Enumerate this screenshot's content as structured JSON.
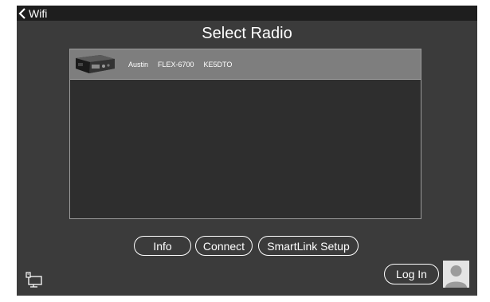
{
  "header": {
    "back_label": "Wifi",
    "back_icon": "chevron-left-icon"
  },
  "page": {
    "title": "Select Radio"
  },
  "radios": [
    {
      "name": "Austin",
      "model": "FLEX-6700",
      "callsign": "KE5DTO",
      "icon": "radio-device-image",
      "selected": true
    }
  ],
  "buttons": {
    "info": "Info",
    "connect": "Connect",
    "smartlink": "SmartLink Setup",
    "login": "Log In"
  },
  "footer": {
    "network_icon": "network-icon",
    "avatar_icon": "user-avatar-icon"
  },
  "colors": {
    "background": "#3b3b3b",
    "topbar": "#1e1e1e",
    "list_bg": "#2e2e2e",
    "selected_row": "#7e7e7e",
    "text": "#ffffff"
  }
}
